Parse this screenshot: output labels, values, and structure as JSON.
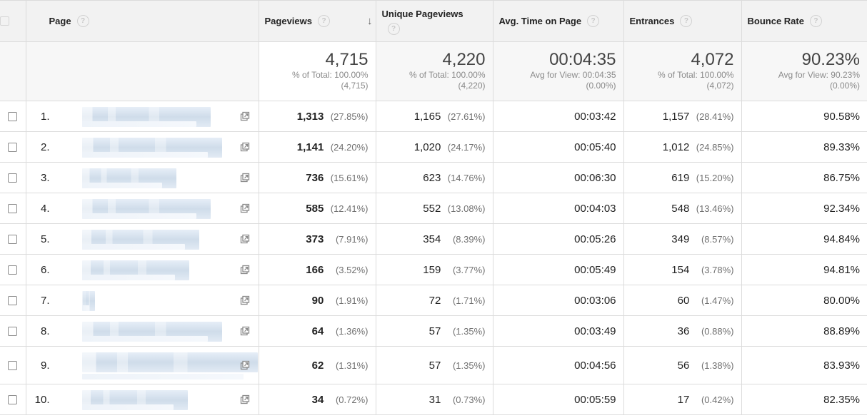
{
  "headers": {
    "page": "Page",
    "pageviews": "Pageviews",
    "unique_pageviews": "Unique Pageviews",
    "avg_time": "Avg. Time on Page",
    "entrances": "Entrances",
    "bounce_rate": "Bounce Rate",
    "help_glyph": "?",
    "sort_glyph": "↓"
  },
  "totals": {
    "pageviews": {
      "value": "4,715",
      "line1": "% of Total: 100.00%",
      "line2": "(4,715)"
    },
    "unique_pageviews": {
      "value": "4,220",
      "line1": "% of Total: 100.00%",
      "line2": "(4,220)"
    },
    "avg_time": {
      "value": "00:04:35",
      "line1": "Avg for View: 00:04:35",
      "line2": "(0.00%)"
    },
    "entrances": {
      "value": "4,072",
      "line1": "% of Total: 100.00%",
      "line2": "(4,072)"
    },
    "bounce_rate": {
      "value": "90.23%",
      "line1": "Avg for View: 90.23%",
      "line2": "(0.00%)"
    }
  },
  "rows": [
    {
      "index": "1.",
      "pv": "1,313",
      "pv_pct": "(27.85%)",
      "upv": "1,165",
      "upv_pct": "(27.61%)",
      "time": "00:03:42",
      "ent": "1,157",
      "ent_pct": "(28.41%)",
      "bounce": "90.58%"
    },
    {
      "index": "2.",
      "pv": "1,141",
      "pv_pct": "(24.20%)",
      "upv": "1,020",
      "upv_pct": "(24.17%)",
      "time": "00:05:40",
      "ent": "1,012",
      "ent_pct": "(24.85%)",
      "bounce": "89.33%"
    },
    {
      "index": "3.",
      "pv": "736",
      "pv_pct": "(15.61%)",
      "upv": "623",
      "upv_pct": "(14.76%)",
      "time": "00:06:30",
      "ent": "619",
      "ent_pct": "(15.20%)",
      "bounce": "86.75%"
    },
    {
      "index": "4.",
      "pv": "585",
      "pv_pct": "(12.41%)",
      "upv": "552",
      "upv_pct": "(13.08%)",
      "time": "00:04:03",
      "ent": "548",
      "ent_pct": "(13.46%)",
      "bounce": "92.34%"
    },
    {
      "index": "5.",
      "pv": "373",
      "pv_pct": "(7.91%)",
      "upv": "354",
      "upv_pct": "(8.39%)",
      "time": "00:05:26",
      "ent": "349",
      "ent_pct": "(8.57%)",
      "bounce": "94.84%"
    },
    {
      "index": "6.",
      "pv": "166",
      "pv_pct": "(3.52%)",
      "upv": "159",
      "upv_pct": "(3.77%)",
      "time": "00:05:49",
      "ent": "154",
      "ent_pct": "(3.78%)",
      "bounce": "94.81%"
    },
    {
      "index": "7.",
      "pv": "90",
      "pv_pct": "(1.91%)",
      "upv": "72",
      "upv_pct": "(1.71%)",
      "time": "00:03:06",
      "ent": "60",
      "ent_pct": "(1.47%)",
      "bounce": "80.00%"
    },
    {
      "index": "8.",
      "pv": "64",
      "pv_pct": "(1.36%)",
      "upv": "57",
      "upv_pct": "(1.35%)",
      "time": "00:03:49",
      "ent": "36",
      "ent_pct": "(0.88%)",
      "bounce": "88.89%"
    },
    {
      "index": "9.",
      "pv": "62",
      "pv_pct": "(1.31%)",
      "upv": "57",
      "upv_pct": "(1.35%)",
      "time": "00:04:56",
      "ent": "56",
      "ent_pct": "(1.38%)",
      "bounce": "83.93%"
    },
    {
      "index": "10.",
      "pv": "34",
      "pv_pct": "(0.72%)",
      "upv": "31",
      "upv_pct": "(0.73%)",
      "time": "00:05:59",
      "ent": "17",
      "ent_pct": "(0.42%)",
      "bounce": "82.35%"
    }
  ],
  "icons": {
    "row_checkbox": "checkbox-icon",
    "open_page": "external-link-icon",
    "help": "help-circle-icon",
    "sort": "arrow-down-icon"
  },
  "colors": {
    "header_bg": "#f2f2f2",
    "totals_bg": "#f7f7f7",
    "border": "#dcdcdc",
    "muted_text": "#8a8a8a",
    "redacted_url": "#d4e0ed"
  }
}
